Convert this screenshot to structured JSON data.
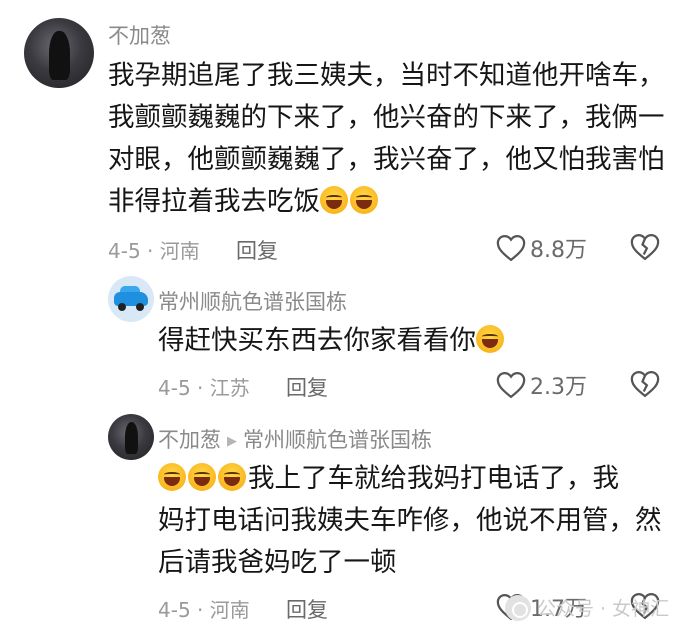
{
  "comments": [
    {
      "username": "不加葱",
      "lines": [
        "我孕期追尾了我三姨夫，当时不知道他开啥车，",
        "我颤颤巍巍的下来了，他兴奋的下来了，我俩一",
        "对眼，他颤颤巍巍了，我兴奋了，他又怕我害怕",
        "非得拉着我去吃饭"
      ],
      "date_location": "4-5 · 河南",
      "reply_label": "回复",
      "likes": "8.8万"
    },
    {
      "username": "常州顺航色谱张国栋",
      "lines": [
        "得赶快买东西去你家看看你"
      ],
      "date_location": "4-5 · 江苏",
      "reply_label": "回复",
      "likes": "2.3万"
    },
    {
      "username": "不加葱",
      "reply_to": "常州顺航色谱张国栋",
      "lines": [
        "我上了车就给我妈打电话了，我",
        "妈打电话问我姨夫车咋修，他说不用管，然",
        "后请我爸妈吃了一顿"
      ],
      "date_location": "4-5 · 河南",
      "reply_label": "回复",
      "likes": "1.7万"
    }
  ],
  "watermark": "公众号 · 女神汇",
  "icons": {
    "emoji": "laughing-crying-emoji-icon",
    "like": "heart-outline-icon",
    "dislike": "broken-heart-icon"
  },
  "colors": {
    "username": "#8a8a8a",
    "text": "#161616",
    "meta": "#9a9a9a"
  }
}
